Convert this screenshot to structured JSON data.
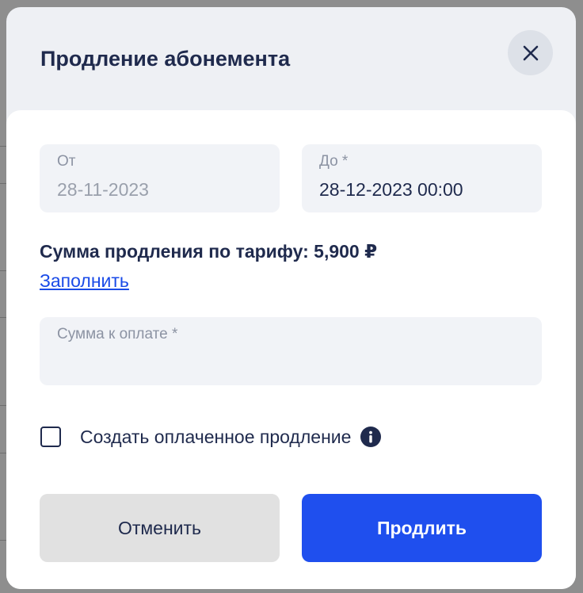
{
  "dialog": {
    "title": "Продление абонемента",
    "close_icon": "close-icon"
  },
  "form": {
    "from": {
      "label": "От",
      "value": "28-11-2023"
    },
    "to": {
      "label": "До *",
      "value": "28-12-2023 00:00"
    },
    "tariff_sum": "Сумма продления по тарифу: 5,900 ₽",
    "fill_link": "Заполнить",
    "payment": {
      "label": "Сумма к оплате *",
      "value": ""
    },
    "paid_checkbox": {
      "label": "Создать оплаченное продление",
      "checked": false,
      "info_icon": "info-icon"
    }
  },
  "buttons": {
    "cancel": "Отменить",
    "renew": "Продлить"
  },
  "colors": {
    "primary": "#1f4fee",
    "title_text": "#1f2a4d",
    "link": "#1a4be8",
    "field_bg": "#f1f3f7",
    "cancel_bg": "#e1e1e1"
  }
}
